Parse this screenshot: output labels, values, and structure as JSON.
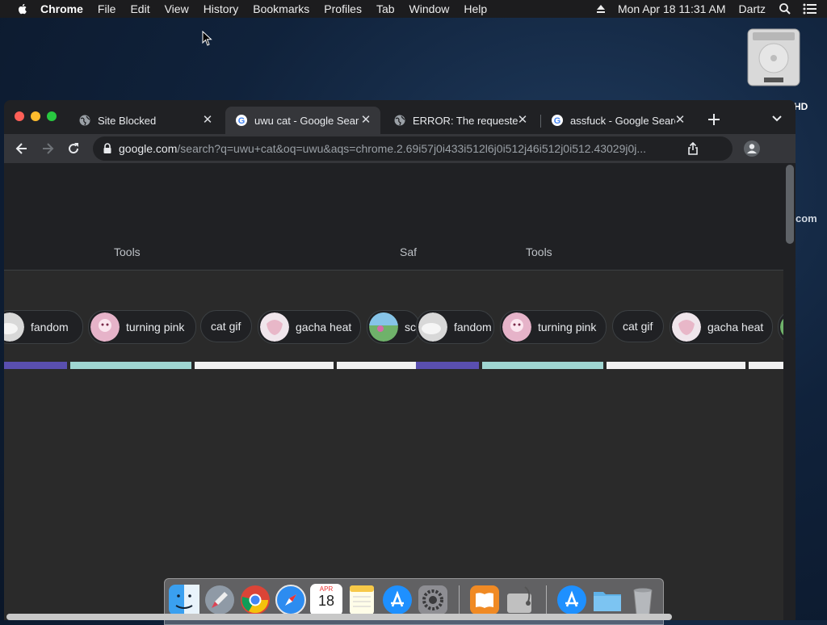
{
  "menubar": {
    "app_name": "Chrome",
    "items": [
      "File",
      "Edit",
      "View",
      "History",
      "Bookmarks",
      "Profiles",
      "Tab",
      "Window",
      "Help"
    ],
    "datetime": "Mon Apr 18  11:31 AM",
    "user": "Dartz",
    "icons": [
      "apple-icon",
      "eject-icon",
      "spotlight-search-icon",
      "control-center-icon"
    ]
  },
  "desktop": {
    "disk_label": "HD",
    "background_text": "com"
  },
  "browser": {
    "tabs": [
      {
        "title": "Site Blocked",
        "favicon": "globe-icon",
        "active": false
      },
      {
        "title": "uwu cat - Google Search",
        "favicon": "google-g-icon",
        "active": true
      },
      {
        "title": "ERROR: The requested URL could not be retrieved",
        "favicon": "globe-icon",
        "active": false
      },
      {
        "title": "assfuck - Google Search",
        "favicon": "google-g-icon",
        "active": false
      }
    ],
    "url_host": "google.com",
    "url_path": "/search?q=uwu+cat&oq=uwu&aqs=chrome.2.69i57j0i433i512l6j0i512j46i512j0i512.43029j0j..."
  },
  "page": {
    "nav_texts": [
      "Tools",
      "Saf",
      "Tools"
    ],
    "chips": [
      {
        "label": "fandom",
        "thumb": "cat-thumb"
      },
      {
        "label": "turning pink",
        "thumb": "anime-pink-thumb"
      },
      {
        "label": "cat gif",
        "thumb": ""
      },
      {
        "label": "gacha heat",
        "thumb": "anime-sketch-thumb"
      },
      {
        "label": "sc",
        "thumb": "game-thumb"
      }
    ],
    "chips_repeat": [
      {
        "label": "fandom",
        "thumb": "cat-thumb"
      },
      {
        "label": "turning pink",
        "thumb": "anime-pink-thumb"
      },
      {
        "label": "cat gif",
        "thumb": ""
      },
      {
        "label": "gacha heat",
        "thumb": "anime-sketch-thumb"
      }
    ]
  },
  "dock": {
    "apps": [
      "finder-icon",
      "launchpad-icon",
      "chrome-icon",
      "safari-icon",
      "calendar-icon",
      "notes-icon",
      "app-store-icon",
      "system-preferences-icon",
      "books-icon",
      "disk-utility-icon",
      "app-store-download-icon",
      "folder-icon",
      "trash-icon"
    ],
    "calendar_month": "APR",
    "calendar_day": "18"
  },
  "colors": {
    "close": "#ff5f57",
    "minimize": "#febc2e",
    "zoom": "#28c840",
    "chrome_dark": "#202124",
    "chrome_toolbar": "#35363a"
  }
}
